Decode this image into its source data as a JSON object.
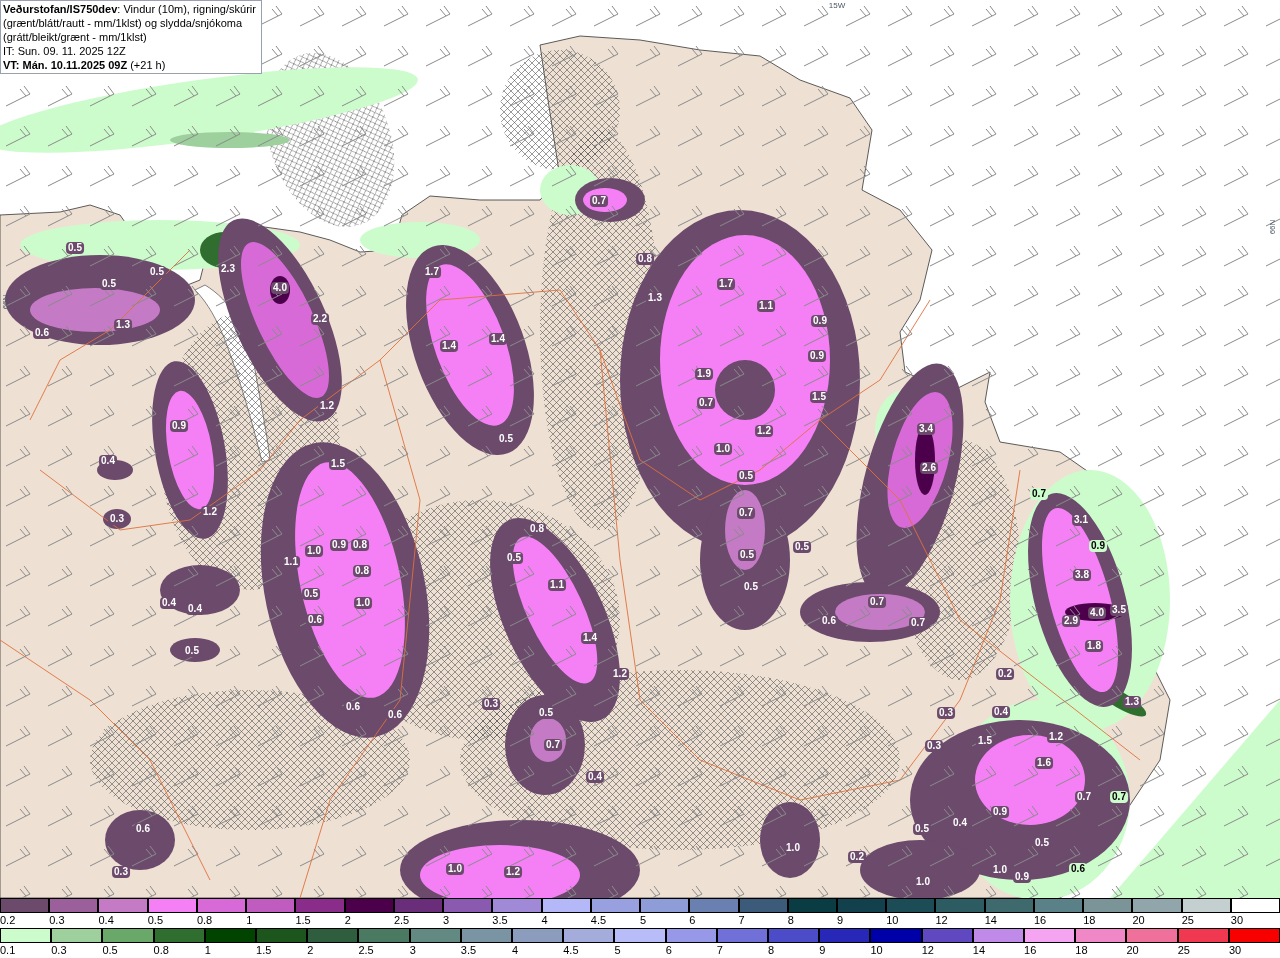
{
  "header": {
    "description": "**Veðurstofan/IS750dev**: Vindur (10m), rigning/skúrir (grænt/blátt/rautt - mm/1klst) og slydda/snjókoma (grátt/bleikt/grænt - mm/1klst)",
    "issue_time": "IT: Sun. 09. 11. 2025 12Z",
    "valid_time": "**VT: Mán. 10.11.2025 09Z** (+21 h)"
  },
  "map": {
    "grid_labels": [
      {
        "text": "15W"
      },
      {
        "text": "66N"
      },
      {
        "text": "66N"
      }
    ],
    "value_labels": [
      {
        "text": "0.5",
        "kind": "snow"
      },
      {
        "text": "0.5",
        "kind": "snow"
      },
      {
        "text": "0.5",
        "kind": "snow"
      },
      {
        "text": "0.6",
        "kind": "snow"
      },
      {
        "text": "1.3",
        "kind": "snow"
      },
      {
        "text": "2.3",
        "kind": "snow"
      },
      {
        "text": "4.0",
        "kind": "snow"
      },
      {
        "text": "2.2",
        "kind": "snow"
      },
      {
        "text": "1.2",
        "kind": "snow"
      },
      {
        "text": "1.7",
        "kind": "snow"
      },
      {
        "text": "1.4",
        "kind": "snow"
      },
      {
        "text": "1.4",
        "kind": "snow"
      },
      {
        "text": "0.5",
        "kind": "snow"
      },
      {
        "text": "0.7",
        "kind": "snow"
      },
      {
        "text": "0.8",
        "kind": "snow"
      },
      {
        "text": "1.3",
        "kind": "snow"
      },
      {
        "text": "1.7",
        "kind": "snow"
      },
      {
        "text": "1.1",
        "kind": "snow"
      },
      {
        "text": "0.9",
        "kind": "snow"
      },
      {
        "text": "0.9",
        "kind": "snow"
      },
      {
        "text": "1.9",
        "kind": "snow"
      },
      {
        "text": "0.7",
        "kind": "snow"
      },
      {
        "text": "1.5",
        "kind": "snow"
      },
      {
        "text": "1.2",
        "kind": "snow"
      },
      {
        "text": "1.0",
        "kind": "snow"
      },
      {
        "text": "0.5",
        "kind": "snow"
      },
      {
        "text": "0.7",
        "kind": "snow"
      },
      {
        "text": "0.5",
        "kind": "snow"
      },
      {
        "text": "0.5",
        "kind": "snow"
      },
      {
        "text": "0.5",
        "kind": "snow"
      },
      {
        "text": "0.9",
        "kind": "snow"
      },
      {
        "text": "1.2",
        "kind": "snow"
      },
      {
        "text": "0.4",
        "kind": "snow"
      },
      {
        "text": "0.3",
        "kind": "snow"
      },
      {
        "text": "0.4",
        "kind": "snow"
      },
      {
        "text": "0.4",
        "kind": "snow"
      },
      {
        "text": "0.5",
        "kind": "snow"
      },
      {
        "text": "1.5",
        "kind": "snow"
      },
      {
        "text": "1.0",
        "kind": "snow"
      },
      {
        "text": "0.9",
        "kind": "snow"
      },
      {
        "text": "0.8",
        "kind": "snow"
      },
      {
        "text": "1.1",
        "kind": "snow"
      },
      {
        "text": "0.8",
        "kind": "snow"
      },
      {
        "text": "0.5",
        "kind": "snow"
      },
      {
        "text": "1.0",
        "kind": "snow"
      },
      {
        "text": "0.6",
        "kind": "snow"
      },
      {
        "text": "0.6",
        "kind": "snow"
      },
      {
        "text": "0.6",
        "kind": "snow"
      },
      {
        "text": "0.8",
        "kind": "snow"
      },
      {
        "text": "0.5",
        "kind": "snow"
      },
      {
        "text": "1.1",
        "kind": "snow"
      },
      {
        "text": "1.4",
        "kind": "snow"
      },
      {
        "text": "1.2",
        "kind": "snow"
      },
      {
        "text": "0.3",
        "kind": "snow"
      },
      {
        "text": "0.5",
        "kind": "snow"
      },
      {
        "text": "0.7",
        "kind": "snow"
      },
      {
        "text": "0.4",
        "kind": "snow"
      },
      {
        "text": "3.4",
        "kind": "snow"
      },
      {
        "text": "2.6",
        "kind": "snow"
      },
      {
        "text": "0.7",
        "kind": "snow"
      },
      {
        "text": "0.6",
        "kind": "snow"
      },
      {
        "text": "0.7",
        "kind": "snow"
      },
      {
        "text": "0.7",
        "kind": "rain"
      },
      {
        "text": "3.1",
        "kind": "snow"
      },
      {
        "text": "0.9",
        "kind": "rain"
      },
      {
        "text": "3.8",
        "kind": "snow"
      },
      {
        "text": "4.0",
        "kind": "snow"
      },
      {
        "text": "3.5",
        "kind": "snow"
      },
      {
        "text": "2.9",
        "kind": "snow"
      },
      {
        "text": "1.8",
        "kind": "snow"
      },
      {
        "text": "1.3",
        "kind": "snow"
      },
      {
        "text": "0.2",
        "kind": "snow"
      },
      {
        "text": "0.3",
        "kind": "snow"
      },
      {
        "text": "0.4",
        "kind": "snow"
      },
      {
        "text": "0.3",
        "kind": "snow"
      },
      {
        "text": "1.5",
        "kind": "snow"
      },
      {
        "text": "1.2",
        "kind": "snow"
      },
      {
        "text": "1.6",
        "kind": "snow"
      },
      {
        "text": "0.7",
        "kind": "snow"
      },
      {
        "text": "0.7",
        "kind": "rain"
      },
      {
        "text": "0.9",
        "kind": "snow"
      },
      {
        "text": "0.4",
        "kind": "snow"
      },
      {
        "text": "0.5",
        "kind": "snow"
      },
      {
        "text": "0.5",
        "kind": "snow"
      },
      {
        "text": "1.0",
        "kind": "snow"
      },
      {
        "text": "0.9",
        "kind": "snow"
      },
      {
        "text": "0.2",
        "kind": "snow"
      },
      {
        "text": "1.0",
        "kind": "snow"
      },
      {
        "text": "0.6",
        "kind": "rain"
      },
      {
        "text": "1.0",
        "kind": "snow"
      },
      {
        "text": "0.6",
        "kind": "snow"
      },
      {
        "text": "0.3",
        "kind": "snow"
      },
      {
        "text": "1.0",
        "kind": "snow"
      },
      {
        "text": "1.2",
        "kind": "snow"
      }
    ]
  },
  "legends": [
    {
      "bins": [
        {
          "label": "0.2",
          "color": "#6b4a6b"
        },
        {
          "label": "0.3",
          "color": "#9b5f9b"
        },
        {
          "label": "0.4",
          "color": "#c47ac4"
        },
        {
          "label": "0.5",
          "color": "#f580f5"
        },
        {
          "label": "0.8",
          "color": "#d86ad8"
        },
        {
          "label": "1",
          "color": "#c05cc0"
        },
        {
          "label": "1.5",
          "color": "#8a2d8a"
        },
        {
          "label": "2",
          "color": "#4c004c"
        },
        {
          "label": "2.5",
          "color": "#6a2d7a"
        },
        {
          "label": "3",
          "color": "#8a5ab0"
        },
        {
          "label": "3.5",
          "color": "#a08ad8"
        },
        {
          "label": "4",
          "color": "#b4b8f8"
        },
        {
          "label": "4.5",
          "color": "#98a0e0"
        },
        {
          "label": "5",
          "color": "#8e9cd8"
        },
        {
          "label": "6",
          "color": "#6a80b0"
        },
        {
          "label": "7",
          "color": "#3c5a7a"
        },
        {
          "label": "8",
          "color": "#0a3c44"
        },
        {
          "label": "9",
          "color": "#12404c"
        },
        {
          "label": "10",
          "color": "#1c4c56"
        },
        {
          "label": "12",
          "color": "#2c5c62"
        },
        {
          "label": "14",
          "color": "#3e6a6e"
        },
        {
          "label": "16",
          "color": "#5a8088"
        },
        {
          "label": "18",
          "color": "#7a9498"
        },
        {
          "label": "20",
          "color": "#90a6aa"
        },
        {
          "label": "25",
          "color": "#c4d0d0"
        },
        {
          "label": "30",
          "color": "#ffffff"
        }
      ]
    },
    {
      "bins": [
        {
          "label": "0.1",
          "color": "#ccfccc"
        },
        {
          "label": "0.3",
          "color": "#9ed09e"
        },
        {
          "label": "0.5",
          "color": "#6aa86a"
        },
        {
          "label": "0.8",
          "color": "#2f6e2f"
        },
        {
          "label": "1",
          "color": "#004400"
        },
        {
          "label": "1.5",
          "color": "#1c561c"
        },
        {
          "label": "2",
          "color": "#2e5e3e"
        },
        {
          "label": "2.5",
          "color": "#4a7a62"
        },
        {
          "label": "3",
          "color": "#628a82"
        },
        {
          "label": "3.5",
          "color": "#7a94a4"
        },
        {
          "label": "4",
          "color": "#8c9cbc"
        },
        {
          "label": "4.5",
          "color": "#a4acdc"
        },
        {
          "label": "5",
          "color": "#b8bcf8"
        },
        {
          "label": "6",
          "color": "#9898e8"
        },
        {
          "label": "7",
          "color": "#7070d8"
        },
        {
          "label": "8",
          "color": "#4c4cc8"
        },
        {
          "label": "9",
          "color": "#2828b8"
        },
        {
          "label": "10",
          "color": "#0000a8"
        },
        {
          "label": "12",
          "color": "#6048c0"
        },
        {
          "label": "14",
          "color": "#c08ae8"
        },
        {
          "label": "16",
          "color": "#f4a4f0"
        },
        {
          "label": "18",
          "color": "#f088c8"
        },
        {
          "label": "20",
          "color": "#f0709c"
        },
        {
          "label": "25",
          "color": "#f03850"
        },
        {
          "label": "30",
          "color": "#f80000"
        }
      ]
    }
  ]
}
